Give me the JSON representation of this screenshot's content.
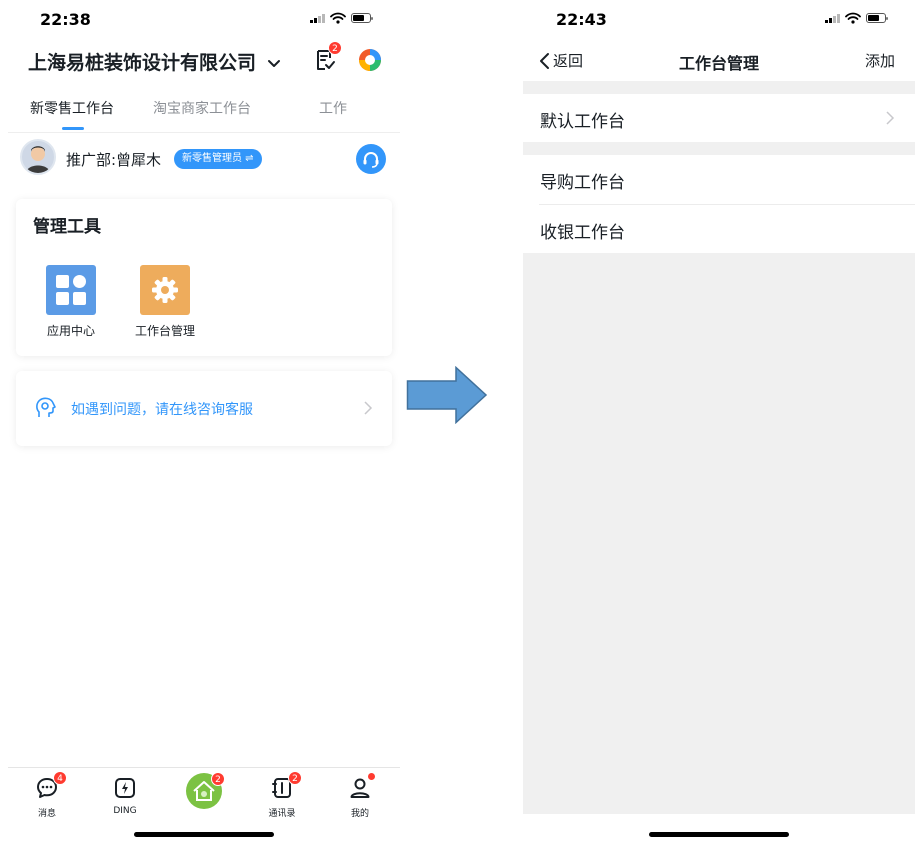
{
  "colors": {
    "accent": "#3296fa",
    "badge": "#ff3b30",
    "app_center_icon": "#5b9be6",
    "workbench_icon": "#eeac5c",
    "arrow": "#5b9bd5"
  },
  "left_screen": {
    "status_time": "22:38",
    "company_name": "上海易桩装饰设计有限公司",
    "todo_badge": "2",
    "tabs": [
      {
        "label": "新零售工作台",
        "active": true
      },
      {
        "label": "淘宝商家工作台",
        "active": false
      },
      {
        "label": "工作",
        "active": false
      }
    ],
    "user": {
      "name": "推广部:曾犀木",
      "role": "新零售管理员 ⇌"
    },
    "tools_card": {
      "title": "管理工具",
      "items": [
        {
          "label": "应用中心",
          "icon": "grid-icon"
        },
        {
          "label": "工作台管理",
          "icon": "gear-icon"
        }
      ]
    },
    "help_text": "如遇到问题，请在线咨询客服",
    "bottom_nav": [
      {
        "label": "消息",
        "badge": "4",
        "icon": "message-icon"
      },
      {
        "label": "DING",
        "badge": "",
        "icon": "ding-icon"
      },
      {
        "label": "",
        "badge": "2",
        "icon": "workbench-home-icon"
      },
      {
        "label": "通讯录",
        "badge": "2",
        "icon": "contacts-icon"
      },
      {
        "label": "我的",
        "badge": "",
        "icon": "profile-icon"
      }
    ]
  },
  "right_screen": {
    "status_time": "22:43",
    "back_label": "返回",
    "title": "工作台管理",
    "add_label": "添加",
    "rows": [
      "默认工作台",
      "导购工作台",
      "收银工作台"
    ]
  }
}
